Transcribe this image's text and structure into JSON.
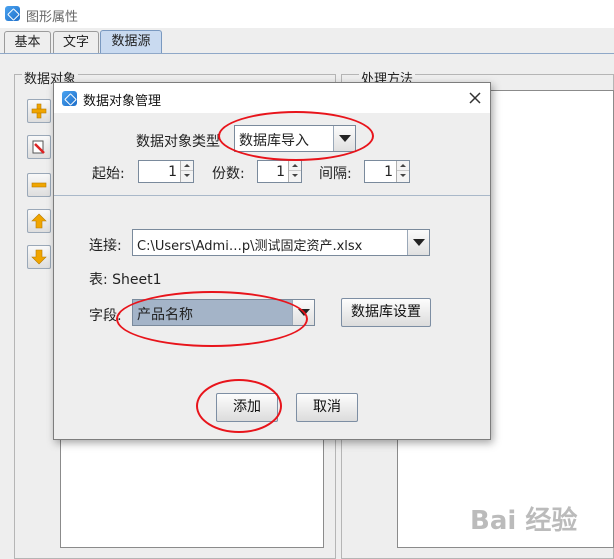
{
  "window": {
    "title": "图形属性"
  },
  "tabs": [
    {
      "label": "基本"
    },
    {
      "label": "文字"
    },
    {
      "label": "数据源",
      "active": true
    }
  ],
  "left_panel": {
    "title": "数据对象",
    "buttons": [
      "add-icon",
      "edit-icon",
      "remove-icon",
      "move-up-icon",
      "move-down-icon"
    ]
  },
  "right_panel": {
    "title": "处理方法"
  },
  "dialog": {
    "title": "数据对象管理",
    "type_label": "数据对象类型",
    "type_value": "数据库导入",
    "start_label": "起始:",
    "start_value": "1",
    "copies_label": "份数:",
    "copies_value": "1",
    "interval_label": "间隔:",
    "interval_value": "1",
    "connect_label": "连接:",
    "connect_value": "C:\\Users\\Admi…p\\测试固定资产.xlsx",
    "table_text": "表: Sheet1",
    "field_label": "字段:",
    "field_value": "产品名称",
    "db_settings_button": "数据库设置",
    "add_button": "添加",
    "cancel_button": "取消"
  },
  "watermark": {
    "text": "Bai 经验"
  },
  "colors": {
    "highlight_ellipse": "#e8141b",
    "active_tab": "#c9daf0",
    "field_highlight": "#a4b4c8"
  }
}
